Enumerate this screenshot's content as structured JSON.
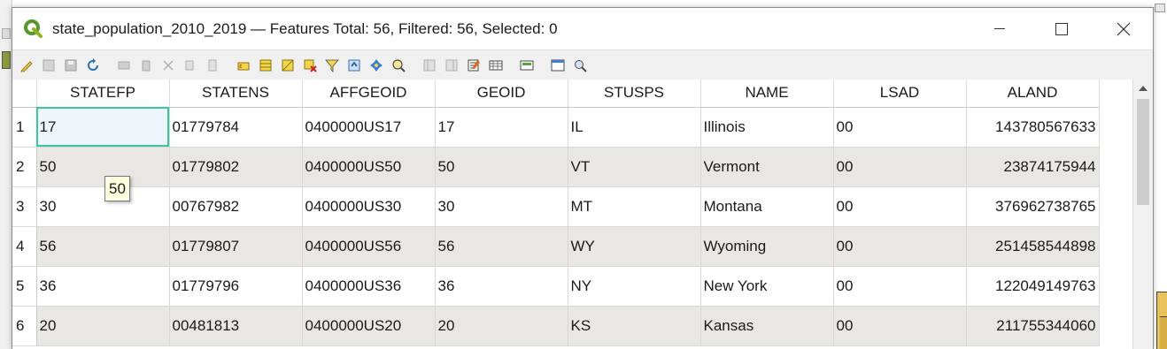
{
  "window": {
    "title": "state_population_2010_2019 — Features Total: 56, Filtered: 56, Selected: 0",
    "app_icon": "qgis-icon"
  },
  "toolbar": {
    "tools": [
      "edit-pencil-icon",
      "multi-edit-icon",
      "save-icon",
      "reload-icon",
      "add-feature-icon",
      "delete-feature-icon",
      "cut-icon",
      "copy-icon",
      "paste-icon",
      "select-expression-icon",
      "select-all-icon",
      "invert-selection-icon",
      "deselect-icon",
      "filter-icon",
      "move-top-icon",
      "pan-to-selected-icon",
      "zoom-to-selected-icon",
      "new-field-icon",
      "delete-field-icon",
      "field-calculator-icon",
      "conditional-format-icon",
      "dock-icon",
      "actions-icon",
      "organize-columns-icon"
    ]
  },
  "table": {
    "columns": [
      "STATEFP",
      "STATENS",
      "AFFGEOID",
      "GEOID",
      "STUSPS",
      "NAME",
      "LSAD",
      "ALAND"
    ],
    "rows": [
      {
        "n": "1",
        "cells": [
          "17",
          "01779784",
          "0400000US17",
          "17",
          "IL",
          "Illinois",
          "00",
          "143780567633"
        ]
      },
      {
        "n": "2",
        "cells": [
          "50",
          "01779802",
          "0400000US50",
          "50",
          "VT",
          "Vermont",
          "00",
          "23874175944"
        ]
      },
      {
        "n": "3",
        "cells": [
          "30",
          "00767982",
          "0400000US30",
          "30",
          "MT",
          "Montana",
          "00",
          "376962738765"
        ]
      },
      {
        "n": "4",
        "cells": [
          "56",
          "01779807",
          "0400000US56",
          "56",
          "WY",
          "Wyoming",
          "00",
          "251458544898"
        ]
      },
      {
        "n": "5",
        "cells": [
          "36",
          "01779796",
          "0400000US36",
          "36",
          "NY",
          "New York",
          "00",
          "122049149763"
        ]
      },
      {
        "n": "6",
        "cells": [
          "20",
          "00481813",
          "0400000US20",
          "20",
          "KS",
          "Kansas",
          "00",
          "211755344060"
        ]
      }
    ]
  },
  "tooltip": {
    "text": "50"
  },
  "colors": {
    "selection_outline": "#3cc79a",
    "alt_row": "#e9e7e3",
    "tooltip_bg": "#ffffe1"
  }
}
